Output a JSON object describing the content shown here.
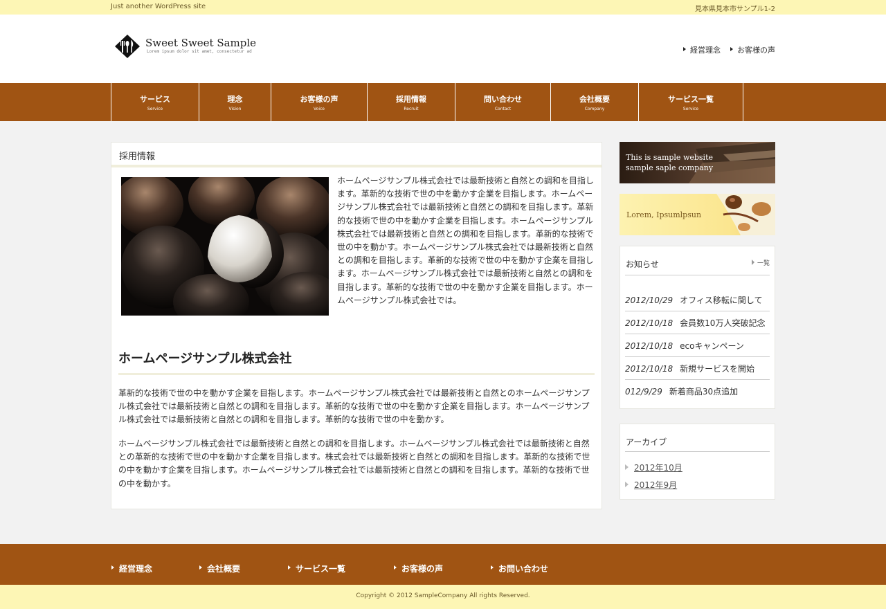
{
  "topbar": {
    "tagline": "Just another WordPress site",
    "address": "見本県見本市サンプル1-2"
  },
  "logo": {
    "title": "Sweet Sweet Sample",
    "subtitle": "Lorem ipsum dolor sit amet, consectetur ad",
    "icon": "cutlery-diamond-icon"
  },
  "header_links": [
    {
      "label": "経営理念"
    },
    {
      "label": "お客様の声"
    }
  ],
  "nav": [
    {
      "jp": "サービス",
      "en": "Service"
    },
    {
      "jp": "理念",
      "en": "Vision"
    },
    {
      "jp": "お客様の声",
      "en": "Voice"
    },
    {
      "jp": "採用情報",
      "en": "Recruit"
    },
    {
      "jp": "問い合わせ",
      "en": "Contact"
    },
    {
      "jp": "会社概要",
      "en": "Company"
    },
    {
      "jp": "サービス一覧",
      "en": "Service"
    }
  ],
  "main": {
    "title": "採用情報",
    "intro": "ホームページサンプル株式会社では最新技術と自然との調和を目指します。革新的な技術で世の中を動かす企業を目指します。ホームページサンプル株式会社では最新技術と自然との調和を目指します。革新的な技術で世の中を動かす企業を目指します。ホームページサンプル株式会社では最新技術と自然との調和を目指します。革新的な技術で世の中を動かす。ホームページサンプル株式会社では最新技術と自然との調和を目指します。革新的な技術で世の中を動かす企業を目指します。ホームページサンプル株式会社では最新技術と自然との調和を目指します。革新的な技術で世の中を動かす企業を目指します。ホームページサンプル株式会社では。",
    "section_title": "ホームページサンプル株式会社",
    "paragraph1": "革新的な技術で世の中を動かす企業を目指します。ホームページサンプル株式会社では最新技術と自然とのホームページサンプル株式会社では最新技術と自然との調和を目指します。革新的な技術で世の中を動かす企業を目指します。ホームページサンプル株式会社では最新技術と自然との調和を目指します。革新的な技術で世の中を動かす。",
    "paragraph2": "ホームページサンプル株式会社では最新技術と自然との調和を目指します。ホームページサンプル株式会社では最新技術と自然との革新的な技術で世の中を動かす企業を目指します。株式会社では最新技術と自然との調和を目指します。革新的な技術で世の中を動かす企業を目指します。ホームページサンプル株式会社では最新技術と自然との調和を目指します。革新的な技術で世の中を動かす。"
  },
  "sidebar": {
    "banner1_line1": "This is sample website",
    "banner1_line2": "sample saple company",
    "banner2": "Lorem, Ipsumlpsun",
    "news": {
      "title": "お知らせ",
      "more": "一覧",
      "items": [
        {
          "date": "2012/10/29",
          "text": "オフィス移転に関して"
        },
        {
          "date": "2012/10/18",
          "text": "会員数10万人突破記念"
        },
        {
          "date": "2012/10/18",
          "text": "ecoキャンペーン"
        },
        {
          "date": "2012/10/18",
          "text": "新規サービスを開始"
        },
        {
          "date": "012/9/29",
          "text": "新着商品30点追加"
        }
      ]
    },
    "archive": {
      "title": "アーカイブ",
      "items": [
        {
          "label": "2012年10月"
        },
        {
          "label": "2012年9月"
        }
      ]
    }
  },
  "footer": {
    "links": [
      {
        "label": "経営理念"
      },
      {
        "label": "会社概要"
      },
      {
        "label": "サービス一覧"
      },
      {
        "label": "お客様の声"
      },
      {
        "label": "お問い合わせ"
      }
    ],
    "copyright": "Copyright © 2012 SampleCompany All rights Reserved."
  },
  "colors": {
    "brand_brown": "#a05413",
    "topbar_yellow": "#fdf6b5"
  }
}
